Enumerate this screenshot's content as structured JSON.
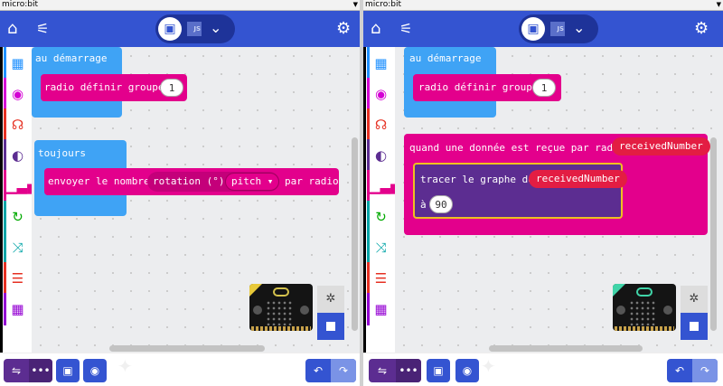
{
  "left": {
    "title": "micro:bit",
    "start_block": {
      "label": "au démarrage"
    },
    "radio_group": {
      "label": "radio définir groupe",
      "value": "1"
    },
    "forever_block": {
      "label": "toujours"
    },
    "send_number": {
      "label": "envoyer le nombre",
      "rotation_label": "rotation (°)",
      "axis_value": "pitch",
      "suffix": "par radio"
    }
  },
  "right": {
    "title": "micro:bit",
    "start_block": {
      "label": "au démarrage"
    },
    "radio_group": {
      "label": "radio définir groupe",
      "value": "1"
    },
    "on_received": {
      "label": "quand une donnée est reçue par radio",
      "var": "receivedNumber"
    },
    "plot_bar": {
      "label": "tracer le graphe de",
      "var": "receivedNumber",
      "to_label": "à",
      "to_value": "90"
    }
  },
  "toolbar": {
    "js_label": "JS"
  },
  "colors": {
    "topbar": "#3454d1",
    "events_blue": "#3fa3f5",
    "radio_pink": "#e3008c",
    "led_purple": "#5c2d91",
    "variable_red": "#e31d43",
    "download_purple": "#5c2d91"
  },
  "icons": [
    "home-icon",
    "share-icon",
    "blocks-icon",
    "chevron-down-icon",
    "gear-icon",
    "grid-icon",
    "radio-icon",
    "headphones-icon",
    "toggle-icon",
    "signal-icon",
    "loop-icon",
    "shuffle-icon",
    "list-icon",
    "calculator-icon",
    "usb-icon",
    "more-icon",
    "save-icon",
    "github-icon",
    "undo-icon",
    "redo-icon",
    "bug-icon",
    "stop-icon"
  ]
}
